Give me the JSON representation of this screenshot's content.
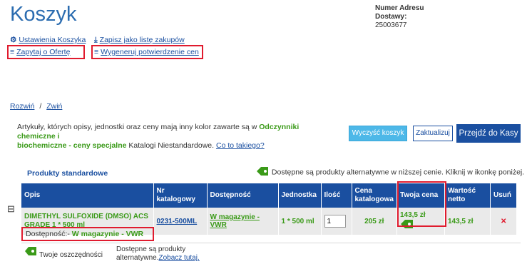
{
  "header": {
    "title": "Koszyk",
    "address_label_1": "Numer Adresu",
    "address_label_2": "Dostawy:",
    "address_value": "25003677"
  },
  "tools": {
    "settings": "Ustawienia Koszyka",
    "save_list": "Zapisz jako listę zakupów",
    "quote": "Zapytaj o Ofertę",
    "confirm": "Wygeneruj potwierdzenie cen"
  },
  "expand": {
    "expand": "Rozwiń",
    "sep": "/",
    "collapse": "Zwiń"
  },
  "notice": {
    "text1": "Artykuły, których opisy, jednostki oraz ceny mają inny kolor zawarte są w ",
    "green1": "Odczynniki chemiczne i",
    "green2": "biochemiczne - ceny specjalne",
    "text2": " Katalogi Niestandardowe. ",
    "link": "Co to takiego?"
  },
  "buttons": {
    "clear": "Wyczyść koszyk",
    "update": "Zaktualizuj",
    "checkout": "Przejdź do Kasy"
  },
  "section": {
    "title": "Produkty standardowe",
    "alt_notice": "Dostępne są produkty alternatywne w niższej cenie. Kliknij w ikonkę poniżej."
  },
  "table": {
    "headers": [
      "Opis",
      "Nr katalogowy",
      "Dostępność",
      "Jednostka",
      "Ilość",
      "Cena katalogowa",
      "Twoja cena",
      "Wartość netto",
      "Usuń"
    ],
    "row": {
      "toggle": "⊟",
      "description": "DIMETHYL SULFOXIDE (DMSO) ACS GRADE 1 * 500 ml",
      "catalog_no": "0231-500ML",
      "availability": "W magazynie - VWR",
      "unit": "1 * 500 ml",
      "qty": "1",
      "list_price": "205 zł",
      "your_price": "143,5 zł",
      "net_value": "143,5 zł",
      "remove": "✕"
    }
  },
  "availability_row": {
    "label": "Dostępność:-",
    "value": "W magazynie - VWR"
  },
  "footer": {
    "savings": "Twoje oszczędności",
    "alt_text": "Dostępne są produkty",
    "alt_text2": "alternatywne.",
    "alt_link": "Zobacz tutaj."
  },
  "colors": {
    "brand_blue": "#1a4fa0",
    "title_blue": "#2b6cb0",
    "green": "#3a9a18",
    "red_box": "#e01b2e"
  }
}
